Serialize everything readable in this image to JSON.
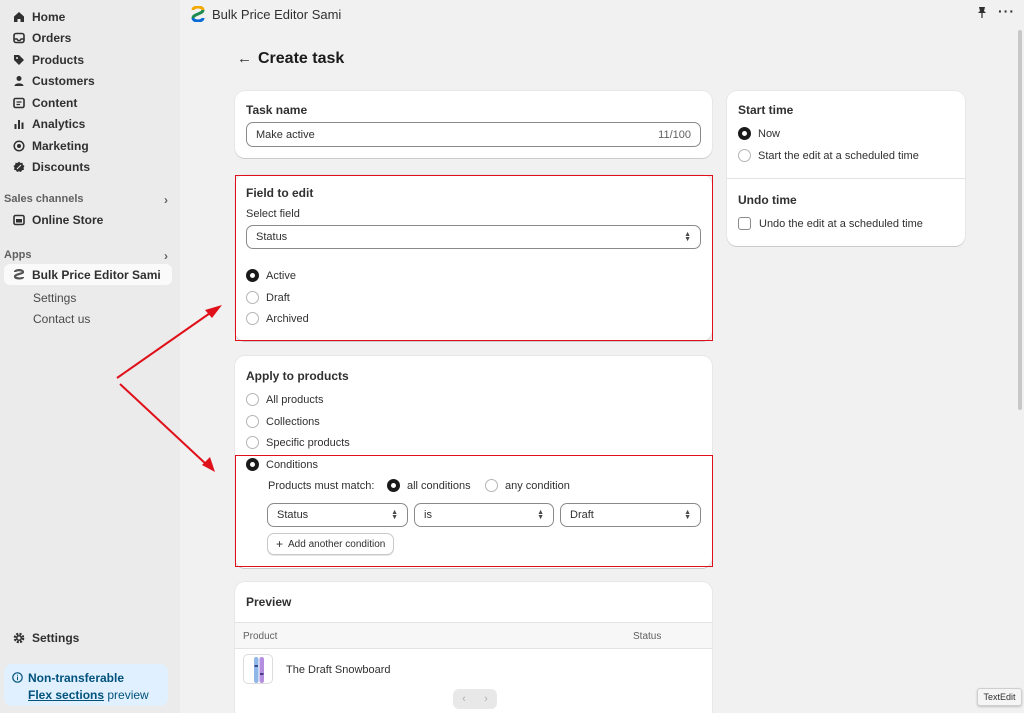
{
  "sidebar": {
    "nav": [
      {
        "label": "Home",
        "icon": "home-icon"
      },
      {
        "label": "Orders",
        "icon": "inbox-icon"
      },
      {
        "label": "Products",
        "icon": "tag-icon"
      },
      {
        "label": "Customers",
        "icon": "person-icon"
      },
      {
        "label": "Content",
        "icon": "content-icon"
      },
      {
        "label": "Analytics",
        "icon": "bar-chart-icon"
      },
      {
        "label": "Marketing",
        "icon": "target-icon"
      },
      {
        "label": "Discounts",
        "icon": "discount-icon"
      }
    ],
    "sales_channels_label": "Sales channels",
    "online_store": "Online Store",
    "apps_label": "Apps",
    "app_name": "Bulk Price Editor Sami",
    "app_settings": "Settings",
    "app_contact": "Contact us",
    "settings": "Settings",
    "banner": {
      "title": "Non-transferable",
      "link": "Flex sections",
      "suffix": " preview"
    }
  },
  "topbar": {
    "app_title": "Bulk Price Editor Sami"
  },
  "page": {
    "title": "Create task"
  },
  "task_name": {
    "title": "Task name",
    "value": "Make active",
    "count": "11/100"
  },
  "field_to_edit": {
    "title": "Field to edit",
    "select_label": "Select field",
    "select_value": "Status",
    "options": [
      "Active",
      "Draft",
      "Archived"
    ],
    "selected": 0
  },
  "apply": {
    "title": "Apply to products",
    "options": [
      "All products",
      "Collections",
      "Specific products",
      "Conditions"
    ],
    "selected": 3,
    "match_label": "Products must match:",
    "match_all": "all conditions",
    "match_any": "any condition",
    "condition": {
      "field": "Status",
      "operator": "is",
      "value": "Draft"
    },
    "add_button": "Add another condition"
  },
  "preview": {
    "title": "Preview",
    "col_product": "Product",
    "col_status": "Status",
    "row_name": "The Draft Snowboard"
  },
  "start_time": {
    "title": "Start time",
    "now": "Now",
    "scheduled": "Start the edit at a scheduled time"
  },
  "undo_time": {
    "title": "Undo time",
    "option": "Undo the edit at a scheduled time"
  },
  "tooltip": "TextEdit",
  "colors": {
    "accent": "#1a1a1a",
    "highlight": "#e0101a",
    "banner_bg": "#e0f0ff"
  }
}
